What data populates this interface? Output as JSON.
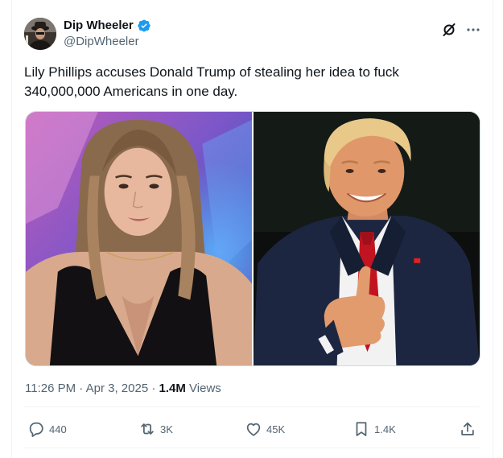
{
  "author": {
    "display_name": "Dip Wheeler",
    "handle": "@DipWheeler",
    "verified": true,
    "avatar_icon": "avatar-photo",
    "verified_icon": "verified-badge-icon",
    "verified_color": "#1d9bf0"
  },
  "header_actions": {
    "grok_icon": "grok-icon",
    "more_icon": "more-icon"
  },
  "tweet": {
    "text": "Lily Phillips accuses Donald Trump of stealing her idea to fuck 340,000,000 Americans in one day."
  },
  "media": [
    {
      "name": "photo-left",
      "description_icon": "photo"
    },
    {
      "name": "photo-right",
      "description_icon": "photo"
    }
  ],
  "meta": {
    "time": "11:26 PM",
    "separator": "·",
    "date": "Apr 3, 2025",
    "views_count": "1.4M",
    "views_label": "Views"
  },
  "actions": {
    "reply": {
      "icon": "reply-icon",
      "count": "440"
    },
    "retweet": {
      "icon": "retweet-icon",
      "count": "3K"
    },
    "like": {
      "icon": "heart-icon",
      "count": "45K"
    },
    "bookmark": {
      "icon": "bookmark-icon",
      "count": "1.4K"
    },
    "share": {
      "icon": "share-icon"
    }
  },
  "colors": {
    "text_primary": "#0f1419",
    "text_secondary": "#536471",
    "border": "#cfd9de",
    "divider": "#eff3f4"
  }
}
